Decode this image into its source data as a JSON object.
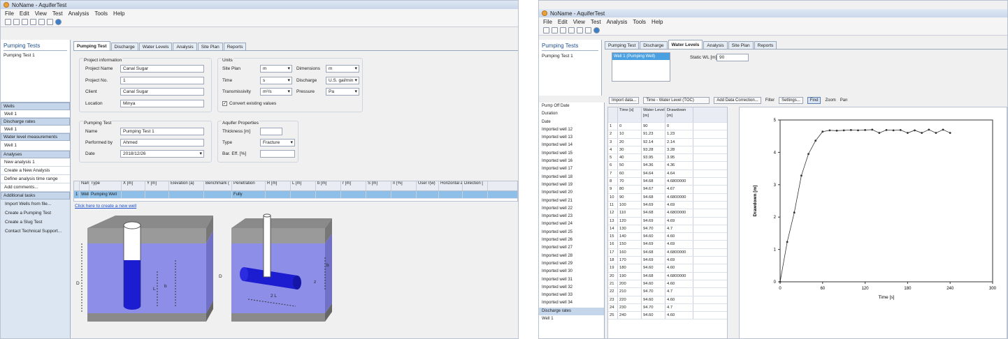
{
  "left": {
    "title": "NoName - AquiferTest",
    "menu": [
      "File",
      "Edit",
      "View",
      "Test",
      "Analysis",
      "Tools",
      "Help"
    ],
    "tabs": [
      "Pumping Test",
      "Discharge",
      "Water Levels",
      "Analysis",
      "Site Plan",
      "Reports"
    ],
    "nav": {
      "title": "Pumping Tests",
      "test": "Pumping Test 1",
      "wells_hdr": "Wells",
      "wells": [
        "Well 1"
      ],
      "discharge_hdr": "Discharge rates",
      "discharge": [
        "Well 1"
      ],
      "wlm_hdr": "Water level measurements",
      "wlm": [
        "Well 1"
      ],
      "analyses_hdr": "Analyses",
      "analyses": [
        "New analysis 1",
        "Create a New Analysis",
        "Define analysis time range",
        "Add comments..."
      ],
      "tasks_hdr": "Additional tasks",
      "tasks": [
        "Import Wells from file...",
        "Create a Pumping Test",
        "Create a Slug Test",
        "Contact Technical Support..."
      ]
    },
    "project": {
      "legend": "Project information",
      "name_l": "Project Name",
      "name_v": "Canal Sugar",
      "no_l": "Project No.",
      "no_v": "1",
      "client_l": "Client",
      "client_v": "Canal Sugar",
      "loc_l": "Location",
      "loc_v": "Minya"
    },
    "units": {
      "legend": "Units",
      "site_l": "Site Plan",
      "site_v": "m",
      "time_l": "Time",
      "time_v": "s",
      "trans_l": "Transmissivity",
      "trans_v": "m²/s",
      "dim_l": "Dimensions",
      "dim_v": "m",
      "dis_l": "Discharge",
      "dis_v": "U.S. gal/min",
      "pres_l": "Pressure",
      "pres_v": "Pa",
      "convert": "Convert existing values"
    },
    "pump": {
      "legend": "Pumping Test",
      "name_l": "Name",
      "name_v": "Pumping Test 1",
      "by_l": "Performed by",
      "by_v": "Ahmed",
      "date_l": "Date",
      "date_v": "2018/12/26"
    },
    "aquifer": {
      "legend": "Aquifer Properties",
      "thick_l": "Thickness [m]",
      "thick_v": "",
      "type_l": "Type",
      "type_v": "Fracture",
      "bar_l": "Bar. Eff. [%]"
    },
    "grid": {
      "headers": [
        "Name",
        "Type",
        "X [m]",
        "Y [m]",
        "Elevation (a)",
        "Benchmark (",
        "Penetration",
        "R [m]",
        "L [m]",
        "b [m]",
        "r [m]",
        "S [m]",
        "n [%]",
        "User r(w)",
        "Horizontal a",
        "Direction ["
      ],
      "row": [
        "1",
        "Well 1",
        "Pumping Well",
        "",
        "",
        "",
        "",
        "Fully"
      ],
      "add_link": "Click here to create a new well"
    },
    "diagram": {
      "labels": [
        "D",
        "b",
        "L",
        "2 L",
        "D",
        "b",
        "z"
      ]
    }
  },
  "right": {
    "title": "NoName - AquiferTest",
    "menu": [
      "File",
      "Edit",
      "View",
      "Test",
      "Analysis",
      "Tools",
      "Help"
    ],
    "tabs": [
      "Pumping Test",
      "Discharge",
      "Water Levels",
      "Analysis",
      "Site Plan",
      "Reports"
    ],
    "nav": {
      "title": "Pumping Tests",
      "test": "Pumping Test 1"
    },
    "well_list_item": "Well 1 (Pumping Well)",
    "static_label": "Static WL [m]",
    "static_value": "90",
    "toolbar": {
      "import": "Import data...",
      "timeaxis": "Time - Water Level (TOC)",
      "datacorr": "Add Data Correction...",
      "filter": "Filter",
      "settings": "Settings...",
      "find": "Find",
      "zoom": "Zoom",
      "pan": "Pan"
    },
    "list": [
      "Pump Off Date",
      "Duration",
      "Date",
      "Imported well 12",
      "Imported well 13",
      "Imported well 14",
      "Imported well 15",
      "Imported well 16",
      "Imported well 17",
      "Imported well 18",
      "Imported well 19",
      "Imported well 20",
      "Imported well 21",
      "Imported well 22",
      "Imported well 23",
      "Imported well 24",
      "Imported well 25",
      "Imported well 26",
      "Imported well 27",
      "Imported well 28",
      "Imported well 29",
      "Imported well 30",
      "Imported well 31",
      "Imported well 32",
      "Imported well 33",
      "Imported well 34"
    ],
    "list_sec": "Discharge rates",
    "list_well": "Well 1",
    "table_headers": [
      "",
      "Time [s]",
      "Water Level [m]",
      "Drawdown [m]"
    ],
    "table_rows": [
      [
        "1",
        "0",
        "90",
        "0"
      ],
      [
        "2",
        "10",
        "91.23",
        "1.23"
      ],
      [
        "3",
        "20",
        "92.14",
        "2.14"
      ],
      [
        "4",
        "30",
        "93.28",
        "3.28"
      ],
      [
        "5",
        "40",
        "93.95",
        "3.95"
      ],
      [
        "6",
        "50",
        "94.36",
        "4.36"
      ],
      [
        "7",
        "60",
        "94.64",
        "4.64"
      ],
      [
        "8",
        "70",
        "94.68",
        "4.6800000"
      ],
      [
        "9",
        "80",
        "94.67",
        "4.67"
      ],
      [
        "10",
        "90",
        "94.68",
        "4.6800000"
      ],
      [
        "11",
        "100",
        "94.69",
        "4.69"
      ],
      [
        "12",
        "110",
        "94.68",
        "4.6800000"
      ],
      [
        "13",
        "120",
        "94.69",
        "4.69"
      ],
      [
        "14",
        "130",
        "94.70",
        "4.7"
      ],
      [
        "15",
        "140",
        "94.60",
        "4.60"
      ],
      [
        "16",
        "150",
        "94.69",
        "4.69"
      ],
      [
        "17",
        "160",
        "94.68",
        "4.6800000"
      ],
      [
        "18",
        "170",
        "94.69",
        "4.69"
      ],
      [
        "19",
        "180",
        "94.60",
        "4.60"
      ],
      [
        "20",
        "190",
        "94.68",
        "4.6800000"
      ],
      [
        "21",
        "200",
        "94.60",
        "4.60"
      ],
      [
        "22",
        "210",
        "94.70",
        "4.7"
      ],
      [
        "23",
        "220",
        "94.60",
        "4.60"
      ],
      [
        "24",
        "230",
        "94.70",
        "4.7"
      ],
      [
        "25",
        "240",
        "94.60",
        "4.60"
      ]
    ]
  },
  "chart_data": {
    "type": "scatter",
    "title": "",
    "xlabel": "Time [s]",
    "ylabel": "Drawdown [m]",
    "xlim": [
      0,
      300
    ],
    "ylim": [
      0,
      5
    ],
    "xticks": [
      "0",
      "60",
      "120",
      "180",
      "240",
      "300"
    ],
    "yticks": [
      "0",
      "1",
      "2",
      "3",
      "4",
      "5"
    ],
    "x": [
      0,
      10,
      20,
      30,
      40,
      50,
      60,
      70,
      80,
      90,
      100,
      110,
      120,
      130,
      140,
      150,
      160,
      170,
      180,
      190,
      200,
      210,
      220,
      230,
      240
    ],
    "y": [
      0,
      1.23,
      2.14,
      3.28,
      3.95,
      4.36,
      4.64,
      4.68,
      4.67,
      4.68,
      4.69,
      4.68,
      4.69,
      4.7,
      4.6,
      4.69,
      4.68,
      4.69,
      4.6,
      4.68,
      4.6,
      4.7,
      4.6,
      4.7,
      4.6
    ],
    "grid": false,
    "color": "#333333"
  }
}
